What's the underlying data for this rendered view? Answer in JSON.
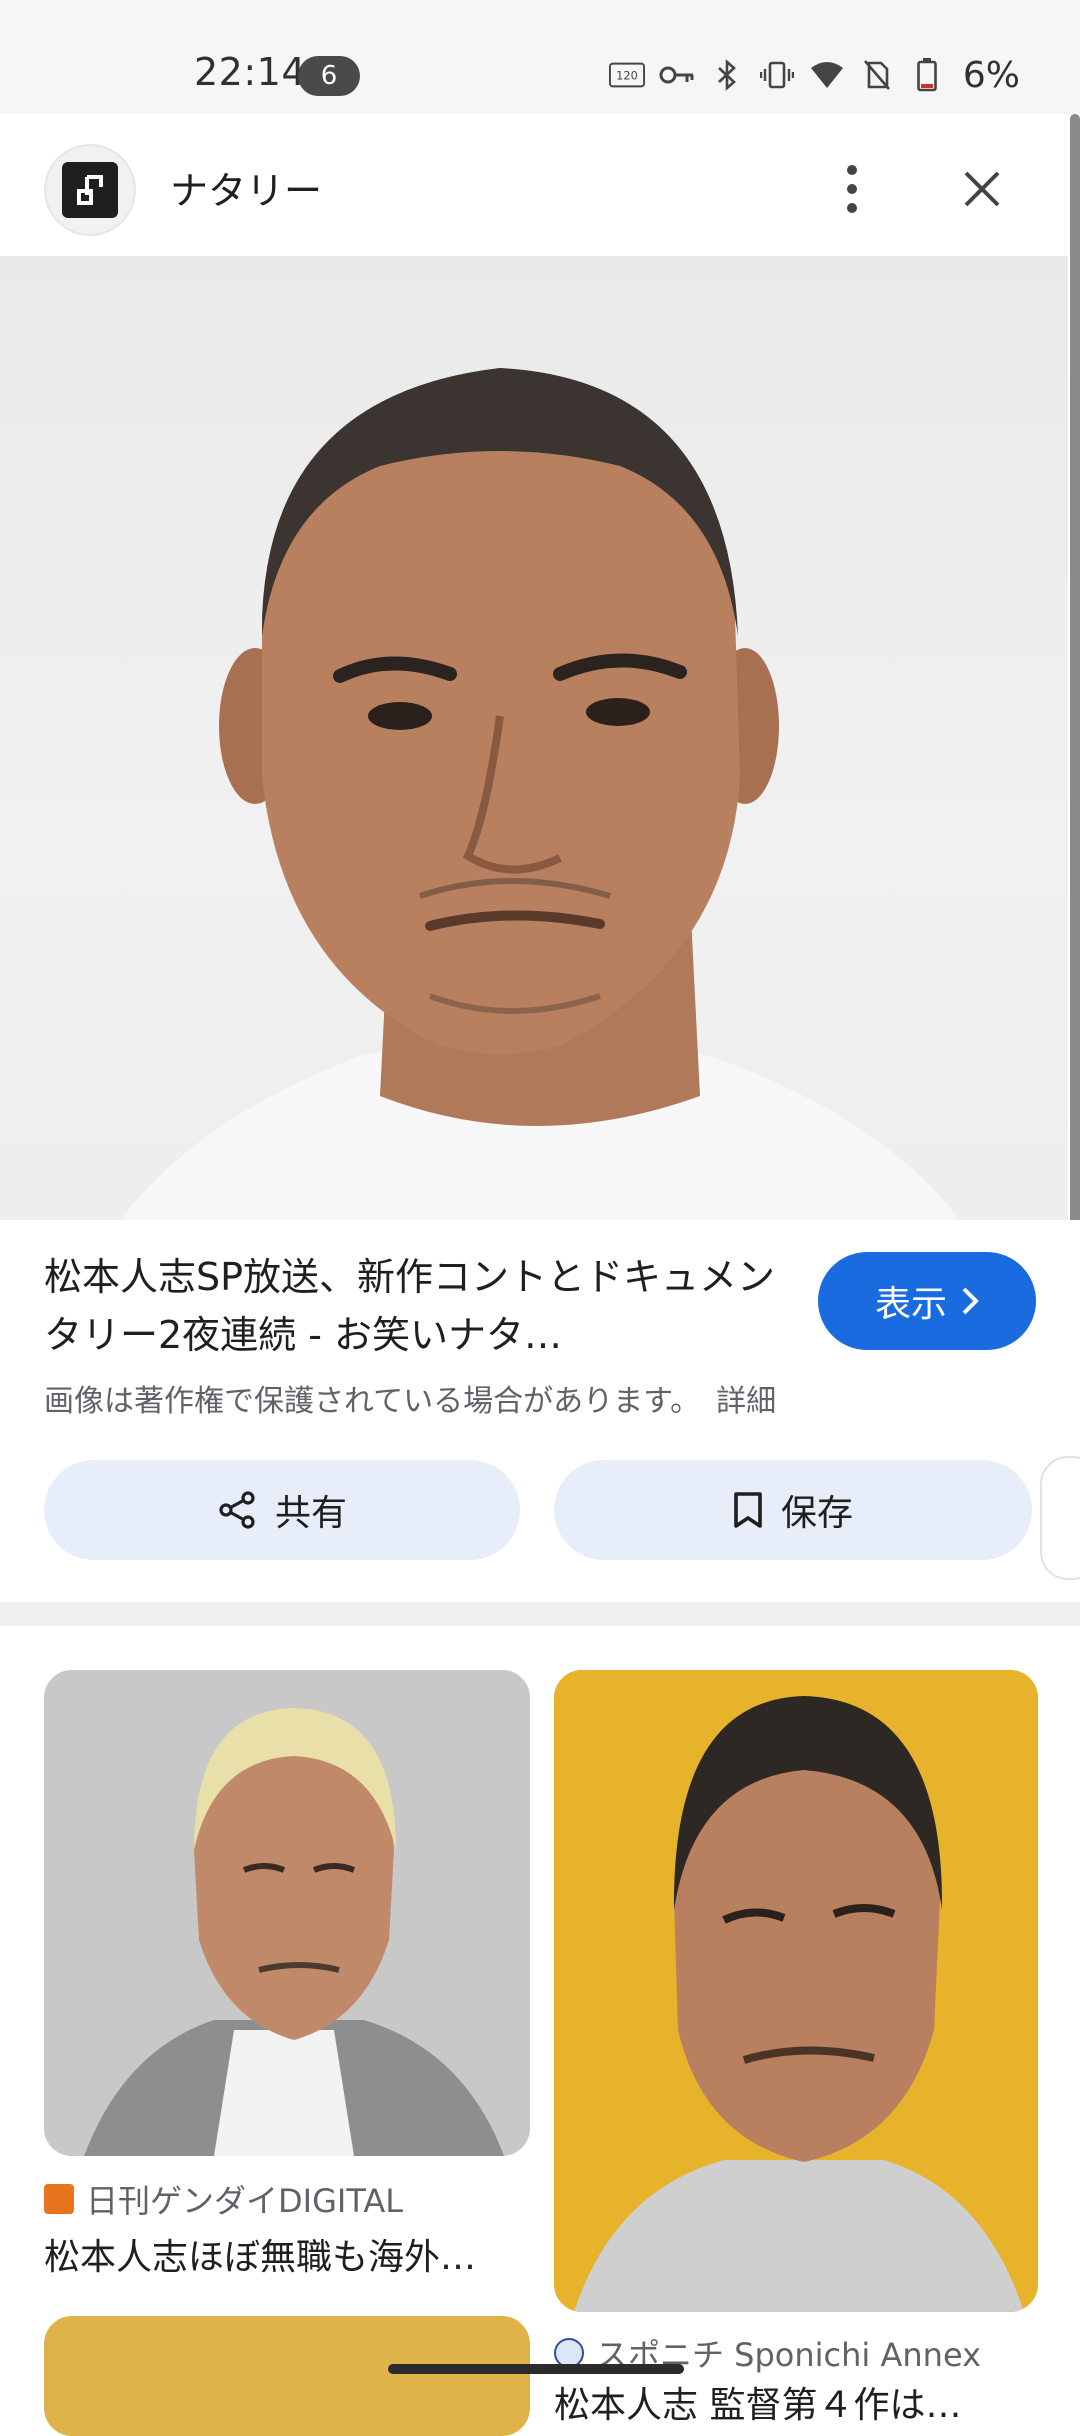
{
  "status_bar": {
    "time": "22:14",
    "notification_count": "6",
    "battery": "6%",
    "icons": [
      "120hz-icon",
      "vpn-key-icon",
      "bluetooth-icon",
      "vibrate-icon",
      "wifi-icon",
      "no-sim-icon",
      "battery-icon"
    ]
  },
  "header": {
    "site_name": "ナタリー",
    "logo_icon": "natalie-logo",
    "more_icon": "more-vert-icon",
    "close_icon": "close-icon"
  },
  "hero": {
    "lens_icon": "google-lens-icon"
  },
  "info": {
    "title": "松本人志SP放送、新作コントとドキュメンタリー2夜連続 - お笑いナタ…",
    "visit_label": "表示",
    "copyright": "画像は著作権で保護されている場合があります。",
    "details_link": "詳細",
    "share_label": "共有",
    "save_label": "保存"
  },
  "related": [
    {
      "source": "日刊ゲンダイDIGITAL",
      "title": "松本人志ほぼ無職も海外…"
    },
    {
      "source": "スポニチ Sponichi Annex",
      "title": "松本人志 監督第４作は…"
    }
  ],
  "colors": {
    "accent": "#1a6ae0",
    "action_bg": "#e8eef9",
    "status_bg": "#f6f6f6"
  }
}
